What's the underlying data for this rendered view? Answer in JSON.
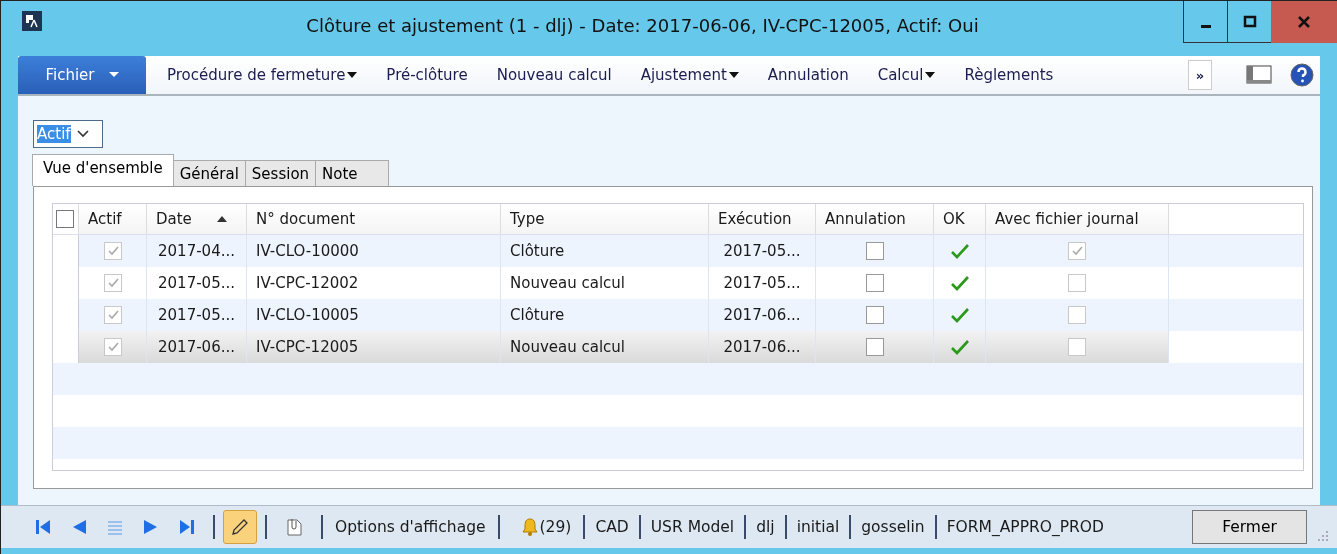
{
  "window": {
    "title": "Clôture et ajustement (1 - dlj) - Date: 2017-06-06, IV-CPC-12005, Actif: Oui"
  },
  "file_menu": {
    "label": "Fichier"
  },
  "menu": [
    {
      "label": "Procédure de fermeture",
      "dropdown": true
    },
    {
      "label": "Pré-clôture",
      "dropdown": false
    },
    {
      "label": "Nouveau calcul",
      "dropdown": false
    },
    {
      "label": "Ajustement",
      "dropdown": true
    },
    {
      "label": "Annulation",
      "dropdown": false
    },
    {
      "label": "Calcul",
      "dropdown": true
    },
    {
      "label": "Règlements",
      "dropdown": false
    }
  ],
  "more_button": {
    "label": "»"
  },
  "filter": {
    "value": "Actif"
  },
  "tabs": [
    {
      "label": "Vue d'ensemble",
      "selected": true
    },
    {
      "label": "Général",
      "selected": false
    },
    {
      "label": "Session",
      "selected": false
    },
    {
      "label": "Note",
      "selected": false
    }
  ],
  "table": {
    "select_all": {
      "checked": false
    },
    "columns": [
      {
        "label": "Actif",
        "sorted": false
      },
      {
        "label": "Date",
        "sorted": true
      },
      {
        "label": "N° document",
        "sorted": false
      },
      {
        "label": "Type",
        "sorted": false
      },
      {
        "label": "Exécution",
        "sorted": false
      },
      {
        "label": "Annulation",
        "sorted": false
      },
      {
        "label": "OK",
        "sorted": false
      },
      {
        "label": "Avec fichier journal",
        "sorted": false
      }
    ],
    "rows": [
      {
        "actif": true,
        "date": "2017-04...",
        "document": "IV-CLO-10000",
        "type": "Clôture",
        "execution": "2017-05...",
        "annulation": false,
        "ok": true,
        "journal": true,
        "selected": false
      },
      {
        "actif": true,
        "date": "2017-05...",
        "document": "IV-CPC-12002",
        "type": "Nouveau calcul",
        "execution": "2017-05...",
        "annulation": false,
        "ok": true,
        "journal": false,
        "selected": false
      },
      {
        "actif": true,
        "date": "2017-05...",
        "document": "IV-CLO-10005",
        "type": "Clôture",
        "execution": "2017-06...",
        "annulation": false,
        "ok": true,
        "journal": false,
        "selected": false
      },
      {
        "actif": true,
        "date": "2017-06...",
        "document": "IV-CPC-12005",
        "type": "Nouveau calcul",
        "execution": "2017-06...",
        "annulation": false,
        "ok": true,
        "journal": false,
        "selected": true
      }
    ]
  },
  "status_bar": {
    "edit_mode": {
      "on": true
    },
    "display_options": "Options d'affichage",
    "notifications": "(29)",
    "fields": [
      "CAD",
      "USR Model",
      "dlj",
      "initial",
      "gosselin",
      "FORM_APPRO_PROD"
    ],
    "close_button": "Fermer"
  }
}
